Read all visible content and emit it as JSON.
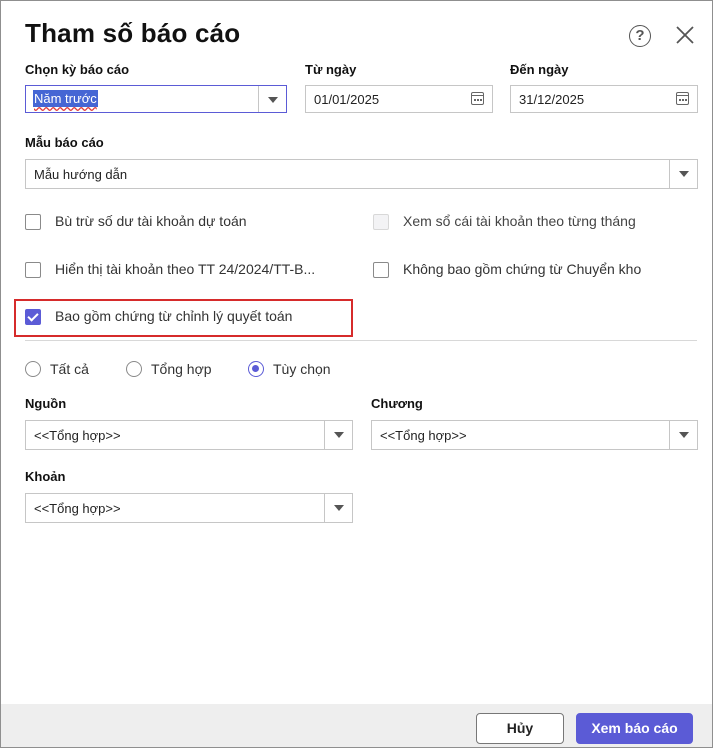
{
  "dialog": {
    "title": "Tham số báo cáo",
    "help_icon": "?",
    "close_icon": "close-icon"
  },
  "period": {
    "label": "Chọn kỳ báo cáo",
    "value": "Năm trước"
  },
  "from_date": {
    "label": "Từ ngày",
    "value": "01/01/2025"
  },
  "to_date": {
    "label": "Đến ngày",
    "value": "31/12/2025"
  },
  "template": {
    "label": "Mẫu báo cáo",
    "value": "Mẫu hướng dẫn"
  },
  "options": {
    "offset_balance": {
      "label": "Bù trừ số dư tài khoản dự toán",
      "checked": false
    },
    "ledger_by_month": {
      "label": "Xem sổ cái tài khoản theo từng tháng",
      "checked": false,
      "disabled": true
    },
    "show_accounts_tt24": {
      "label": "Hiển thị tài khoản theo TT 24/2024/TT-B...",
      "checked": false
    },
    "exclude_warehouse_transfer": {
      "label": "Không bao gồm chứng từ Chuyển kho",
      "checked": false
    },
    "include_adjustment_docs": {
      "label": "Bao gồm chứng từ chỉnh lý quyết toán",
      "checked": true
    }
  },
  "scope": {
    "all": {
      "label": "Tất cả",
      "selected": false
    },
    "summary": {
      "label": "Tổng hợp",
      "selected": false
    },
    "custom": {
      "label": "Tùy chọn",
      "selected": true
    }
  },
  "source": {
    "label": "Nguồn",
    "value": "<<Tổng hợp>>"
  },
  "chapter": {
    "label": "Chương",
    "value": "<<Tổng hợp>>"
  },
  "item": {
    "label": "Khoản",
    "value": "<<Tổng hợp>>"
  },
  "footer": {
    "cancel_label": "Hủy",
    "view_report_label": "Xem báo cáo"
  },
  "colors": {
    "accent": "#5b5bd6",
    "highlight_border": "#d62b2b",
    "footer_bg": "#eeeeee"
  }
}
